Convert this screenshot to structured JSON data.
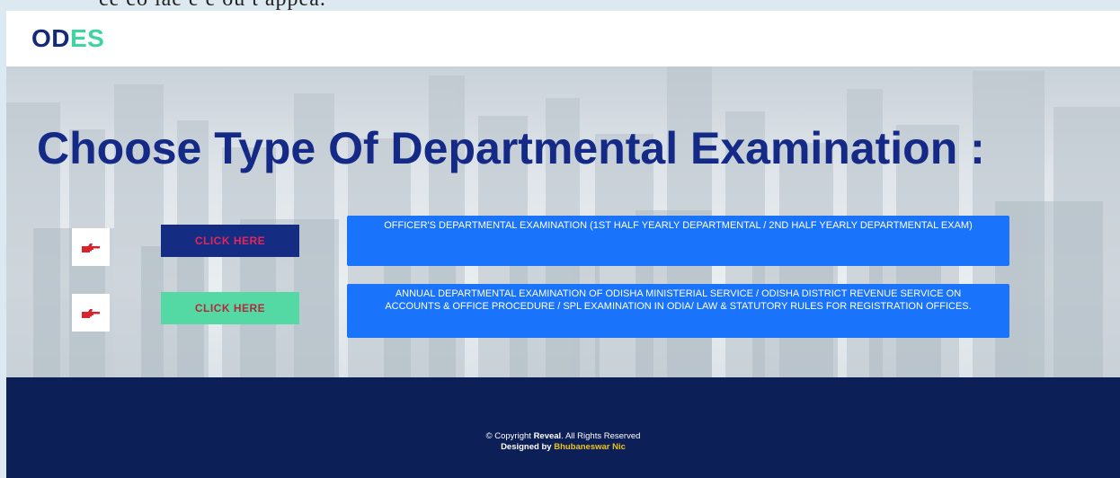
{
  "top_strip_text": "ce co iae e e ou t appea.",
  "brand": {
    "part1": "OD",
    "part2": "ES"
  },
  "hero": {
    "title": "Choose Type Of Departmental Examination :"
  },
  "exams": [
    {
      "hand_icon": "pointing-hand-icon",
      "button_label": "CLICK HERE",
      "description": "OFFICER'S DEPARTMENTAL EXAMINATION (1ST HALF YEARLY DEPARTMENTAL / 2ND HALF YEARLY DEPARTMENTAL EXAM)"
    },
    {
      "hand_icon": "pointing-hand-icon",
      "button_label": "CLICK HERE",
      "description": "ANNUAL DEPARTMENTAL EXAMINATION OF ODISHA MINISTERIAL SERVICE / ODISHA DISTRICT REVENUE SERVICE ON ACCOUNTS & OFFICE PROCEDURE / SPL EXAMINATION IN ODIA/ LAW & STATUTORY RULES FOR REGISTRATION OFFICES."
    }
  ],
  "footer": {
    "copyright_prefix": "© Copyright",
    "company": "Reveal",
    "rights": ". All Rights Reserved",
    "designed_prefix": "Designed by",
    "designer": "Bhubaneswar Nic"
  },
  "colors": {
    "brand_dark": "#142a78",
    "brand_accent": "#3fd3a1",
    "title": "#152a86",
    "exam_box": "#1a73fb",
    "footer_bg": "#0c1f56",
    "designer": "#f0c419"
  }
}
